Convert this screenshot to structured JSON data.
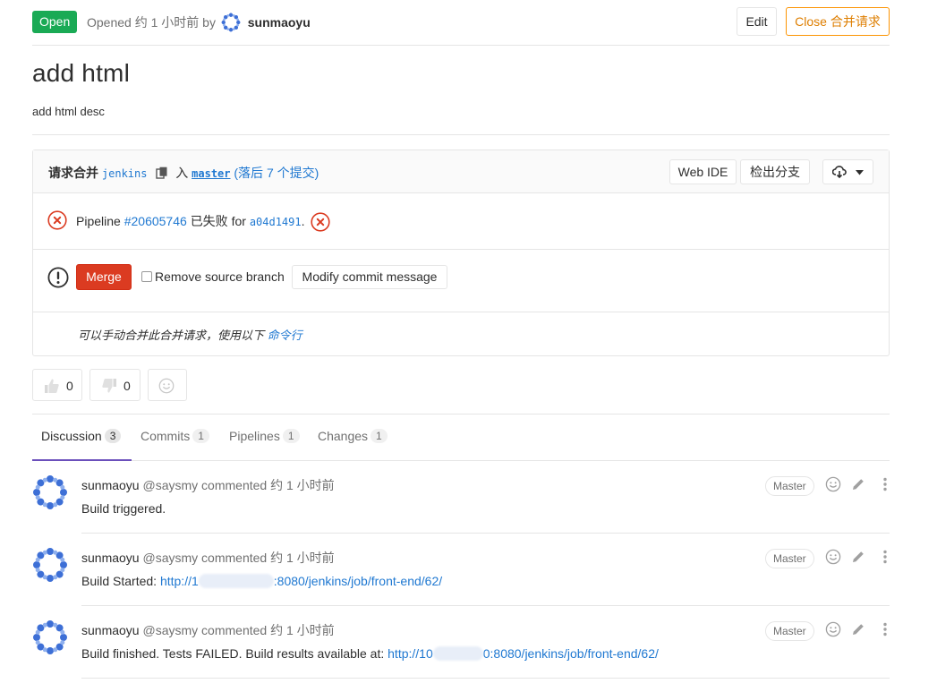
{
  "header": {
    "status": "Open",
    "opened_prefix": "Opened 约 1 小时前 by",
    "author": "sunmaoyu",
    "edit_label": "Edit",
    "close_label": "Close 合并请求"
  },
  "mr": {
    "title": "add html",
    "description": "add html desc"
  },
  "widget": {
    "request_label": "请求合并",
    "source_branch": "jenkins",
    "into_label": "入",
    "target_branch": "master",
    "behind_text": "(落后 7 个提交)",
    "web_ide_label": "Web IDE",
    "checkout_label": "检出分支",
    "download_icon": "cloud-download-icon",
    "pipeline": {
      "prefix": "Pipeline",
      "id": "#20605746",
      "status_text": "已失败",
      "for_label": "for",
      "sha": "a04d1491",
      "period": "."
    },
    "merge_label": "Merge",
    "remove_source_label": "Remove source branch",
    "modify_commit_label": "Modify commit message",
    "manual_text": "可以手动合并此合并请求，使用以下",
    "manual_link": "命令行"
  },
  "awards": {
    "thumbs_up_count": "0",
    "thumbs_down_count": "0"
  },
  "tabs": [
    {
      "label": "Discussion",
      "count": "3"
    },
    {
      "label": "Commits",
      "count": "1"
    },
    {
      "label": "Pipelines",
      "count": "1"
    },
    {
      "label": "Changes",
      "count": "1"
    }
  ],
  "notes": [
    {
      "author": "sunmaoyu",
      "handle": "@saysmy",
      "action": "commented",
      "time": "约 1 小时前",
      "role": "Master",
      "text": "Build triggered.",
      "link_a": "",
      "link_b": ""
    },
    {
      "author": "sunmaoyu",
      "handle": "@saysmy",
      "action": "commented",
      "time": "约 1 小时前",
      "role": "Master",
      "text": "Build Started:",
      "link_a": "http://1",
      "link_b": ":8080/jenkins/job/front-end/62/"
    },
    {
      "author": "sunmaoyu",
      "handle": "@saysmy",
      "action": "commented",
      "time": "约 1 小时前",
      "role": "Master",
      "text": "Build finished. Tests FAILED. Build results available at:",
      "link_a": "http://10",
      "link_b": "0:8080/jenkins/job/front-end/62/"
    }
  ],
  "colors": {
    "open_green": "#1aaa55",
    "merge_red": "#db3b21",
    "close_orange": "#fc9403",
    "link_blue": "#1f78d1",
    "tab_active": "#6b4fbb"
  }
}
